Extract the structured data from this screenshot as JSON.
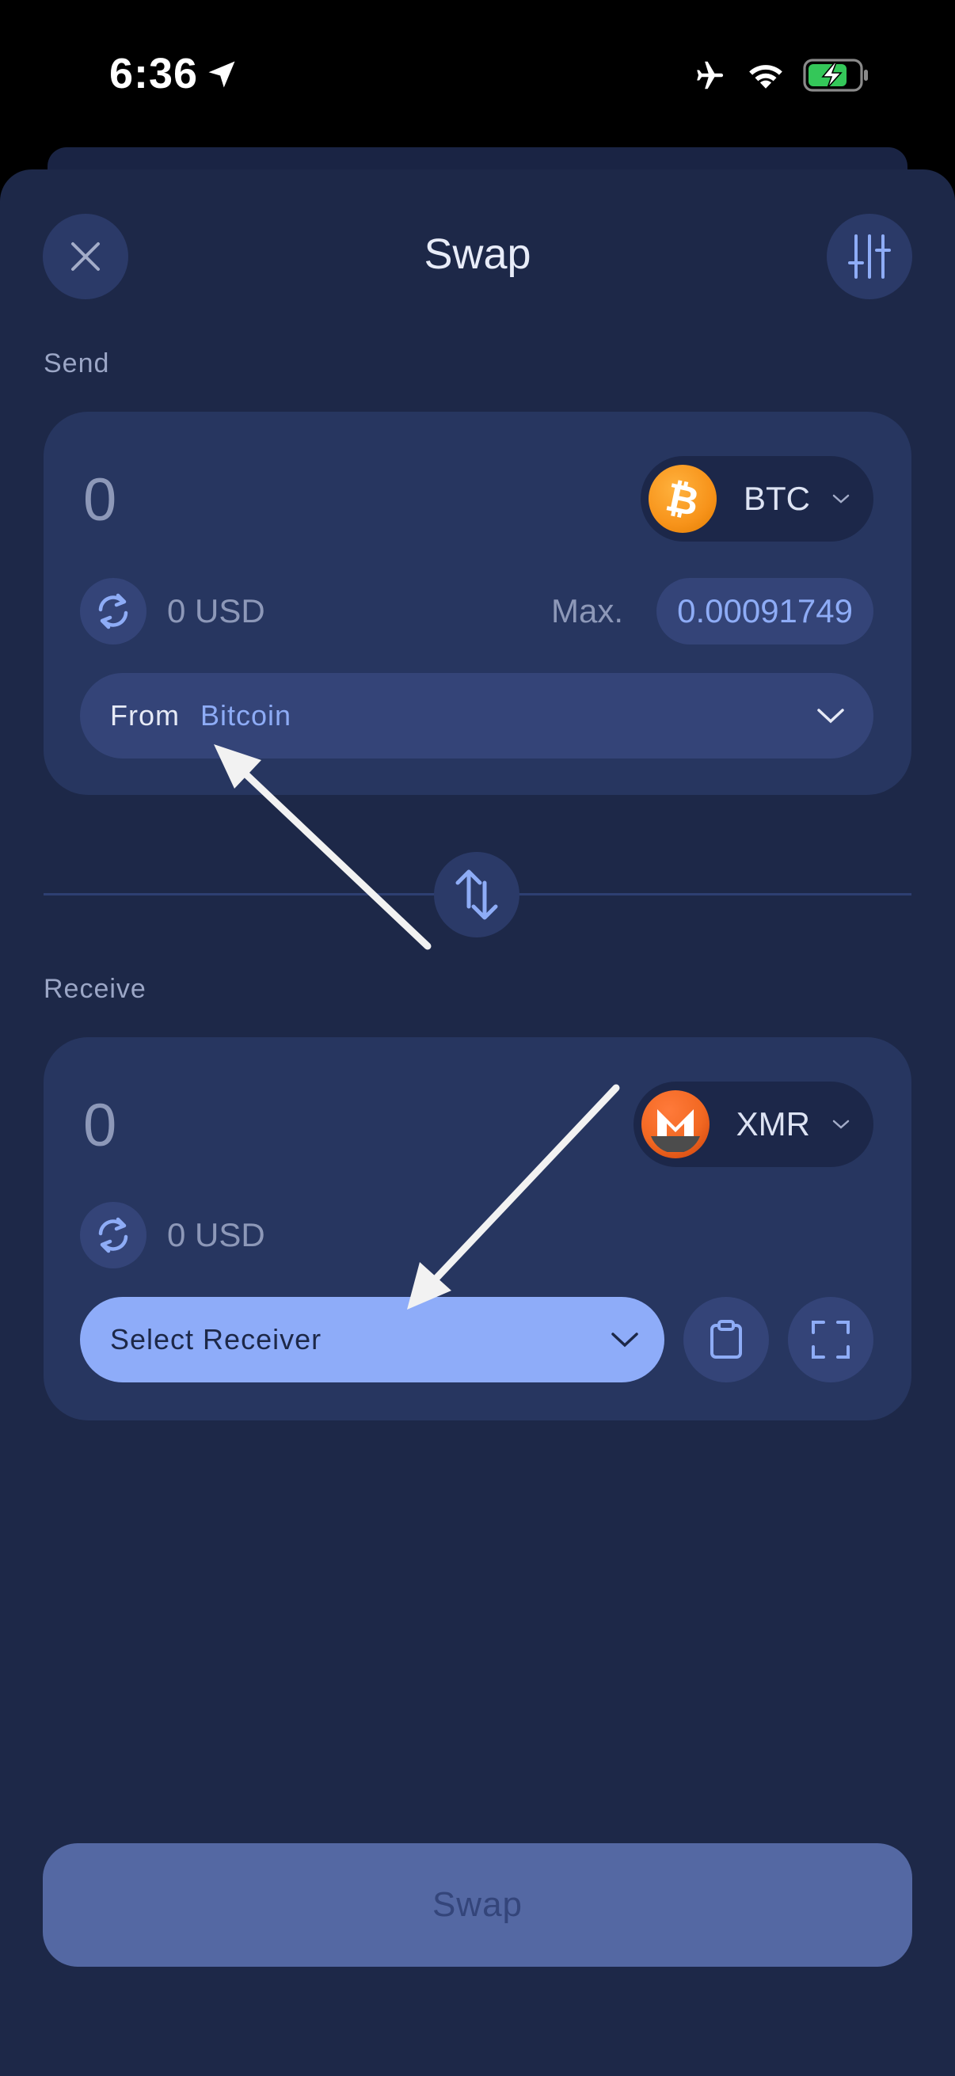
{
  "status_bar": {
    "time": "6:36",
    "icons": [
      "location-arrow-icon",
      "airplane-icon",
      "wifi-icon",
      "battery-charging-icon"
    ]
  },
  "header": {
    "title": "Swap",
    "close_icon": "close-icon",
    "settings_icon": "sliders-icon"
  },
  "send": {
    "label": "Send",
    "amount": "0",
    "asset": "BTC",
    "asset_icon": "bitcoin-icon",
    "usd_value": "0 USD",
    "max_label": "Max.",
    "max_value": "0.00091749",
    "from_label": "From",
    "from_value": "Bitcoin"
  },
  "flip_icon": "swap-vertical-icon",
  "receive": {
    "label": "Receive",
    "amount": "0",
    "asset": "XMR",
    "asset_icon": "monero-icon",
    "usd_value": "0 USD",
    "select_receiver": "Select Receiver",
    "paste_icon": "clipboard-icon",
    "scan_icon": "scan-icon"
  },
  "footer": {
    "swap_button": "Swap"
  },
  "colors": {
    "background": "#1d2848",
    "panel": "#273660",
    "accent": "#8eacf9",
    "bitcoin": "#f7931a",
    "monero": "#f26822"
  }
}
